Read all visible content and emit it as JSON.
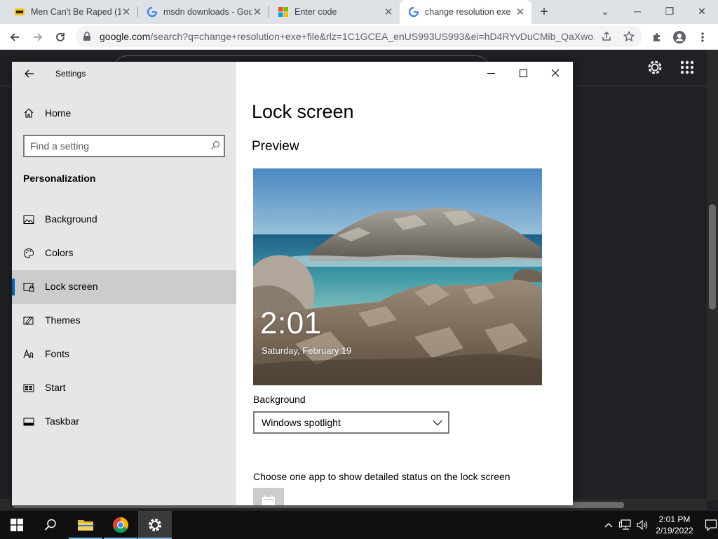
{
  "browser": {
    "tabs": [
      {
        "title": "Men Can't Be Raped (1",
        "favicon": "imdb-icon",
        "active": false
      },
      {
        "title": "msdn downloads - Goo",
        "favicon": "google-g-icon",
        "active": false
      },
      {
        "title": "Enter code",
        "favicon": "microsoft-logo-icon",
        "active": false
      },
      {
        "title": "change resolution exe",
        "favicon": "google-g-icon",
        "active": true
      }
    ],
    "new_tab_label": "+",
    "url_host": "google.com",
    "url_rest": "/search?q=change+resolution+exe+file&rlz=1C1GCEA_enUS993US993&ei=hD4RYvDuCMib_QaXwo..."
  },
  "settings": {
    "app_title": "Settings",
    "home_label": "Home",
    "search_placeholder": "Find a setting",
    "section_heading": "Personalization",
    "nav_items": [
      {
        "label": "Background",
        "icon": "image-icon",
        "selected": false
      },
      {
        "label": "Colors",
        "icon": "palette-icon",
        "selected": false
      },
      {
        "label": "Lock screen",
        "icon": "lock-screen-icon",
        "selected": true
      },
      {
        "label": "Themes",
        "icon": "themes-icon",
        "selected": false
      },
      {
        "label": "Fonts",
        "icon": "fonts-icon",
        "selected": false
      },
      {
        "label": "Start",
        "icon": "start-icon",
        "selected": false
      },
      {
        "label": "Taskbar",
        "icon": "taskbar-icon",
        "selected": false
      }
    ],
    "page_title": "Lock screen",
    "preview_heading": "Preview",
    "preview": {
      "time": "2:01",
      "date": "Saturday, February 19"
    },
    "background_label": "Background",
    "background_value": "Windows spotlight",
    "detail_label": "Choose one app to show detailed status on the lock screen"
  },
  "taskbar": {
    "time": "2:01 PM",
    "date": "2/19/2022",
    "accent_color": "#76b9ed"
  },
  "colors": {
    "selection_bar": "#0063b1",
    "nav_bg": "#e6e6e6",
    "selected_bg": "#cccccc"
  }
}
